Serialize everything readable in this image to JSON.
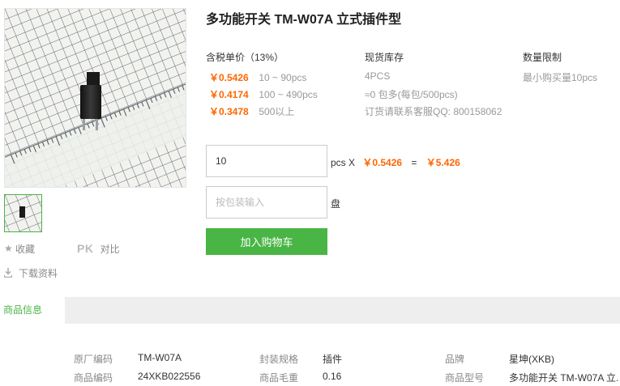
{
  "product": {
    "title": "多功能开关 TM-W07A 立式插件型"
  },
  "gallery": {
    "main_image_alt": "product photo",
    "thumbnail_alt": "thumbnail"
  },
  "actions": {
    "favorite_label": "收藏",
    "pk_label": "PK",
    "compare_label": "对比",
    "download_label": "下载资料"
  },
  "pricing": {
    "header": "含税单价（13%）",
    "tiers": [
      {
        "price": "￥0.5426",
        "range": "10 ~ 90pcs"
      },
      {
        "price": "￥0.4174",
        "range": "100 ~ 490pcs"
      },
      {
        "price": "￥0.3478",
        "range": "500以上"
      }
    ]
  },
  "stock": {
    "header": "现货库存",
    "lines": [
      "4PCS",
      "≈0 包多(每包/500pcs)",
      "订货请联系客服QQ: 800158062"
    ]
  },
  "limit": {
    "header": "数量限制",
    "text": "最小购买量10pcs"
  },
  "order": {
    "quantity_value": "10",
    "unit_label": "pcs X",
    "unit_price": "￥0.5426",
    "equals": "=",
    "total": "￥5.426",
    "pack_placeholder": "按包装输入",
    "pack_unit": "盘",
    "add_to_cart": "加入购物车"
  },
  "tabs": {
    "active_label": "商品信息"
  },
  "info": {
    "rows": [
      [
        {
          "label": "原厂编码",
          "value": "TM-W07A"
        },
        {
          "label": "封装规格",
          "value": "插件"
        },
        {
          "label": "品牌",
          "value": "星坤(XKB)"
        }
      ],
      [
        {
          "label": "商品编码",
          "value": "24XKB022556"
        },
        {
          "label": "商品毛重",
          "value": "0.16"
        },
        {
          "label": "商品型号",
          "value": "多功能开关 TM-W07A 立."
        }
      ]
    ]
  },
  "colors": {
    "accent_green": "#49b544",
    "price_orange": "#ff6600"
  }
}
